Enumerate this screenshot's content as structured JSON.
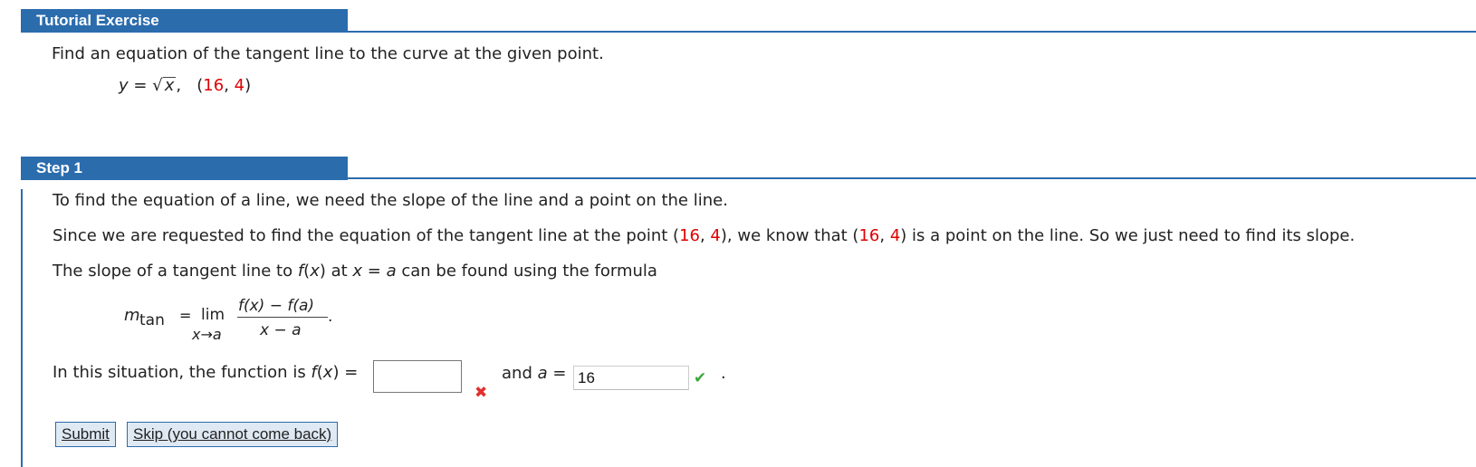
{
  "tutorial": {
    "header": "Tutorial Exercise",
    "prompt": "Find an equation of the tangent line to the curve at the given point.",
    "eq_y": "y",
    "eq_equals": "=",
    "eq_radical": "√",
    "eq_x": "x",
    "eq_comma": ",",
    "point_open": "(",
    "point_x": "16",
    "point_sep": ",",
    "point_y": "4",
    "point_close": ")"
  },
  "step1": {
    "header": "Step 1",
    "line1": "To find the equation of a line, we need the slope of the line and a point on the line.",
    "line2_a": "Since we are requested to find the equation of the tangent line at the point (",
    "line2_x1": "16",
    "line2_sep1": ", ",
    "line2_y1": "4",
    "line2_b": "), we know that (",
    "line2_x2": "16",
    "line2_sep2": ", ",
    "line2_y2": "4",
    "line2_c": ") is a point on the line. So we just need to find its slope.",
    "line3_a": "The slope of a tangent line to ",
    "line3_fx": "f",
    "line3_b": "(",
    "line3_x": "x",
    "line3_c": ") at ",
    "line3_x2": "x",
    "line3_d": " = ",
    "line3_a2": "a",
    "line3_e": " can be found using the formula",
    "formula": {
      "m": "m",
      "m_sub": "tan",
      "equals": "=",
      "lim": "lim",
      "lim_sub": "x→a",
      "numerator": "f(x) − f(a)",
      "denominator": "x − a",
      "period": "."
    },
    "question_a": "In this situation, the function is ",
    "question_fx": "f",
    "question_b": "(",
    "question_x": "x",
    "question_c": ") =",
    "and_label": "and ",
    "a_var": "a",
    "a_equals": " =",
    "a_value": "16",
    "trailing_period": ".",
    "fx_answer": "",
    "fx_status": "incorrect",
    "a_status": "correct",
    "xmark_glyph": "✖",
    "check_glyph": "✔"
  },
  "buttons": {
    "submit": "Submit",
    "skip": "Skip (you cannot come back)"
  },
  "colors": {
    "header_bg": "#2b6cad",
    "highlight": "#e00000",
    "correct": "#3aa83a",
    "incorrect": "#e03030"
  }
}
